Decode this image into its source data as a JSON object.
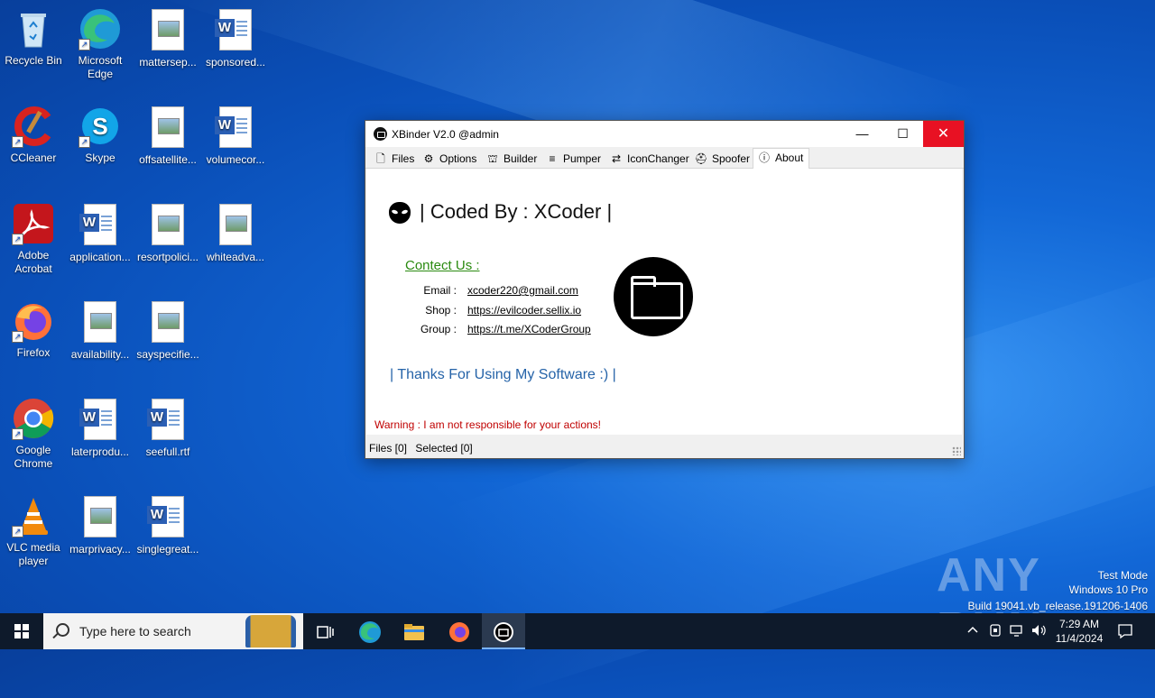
{
  "desktop": {
    "icons": [
      {
        "label": "Recycle Bin"
      },
      {
        "label": "Microsoft Edge"
      },
      {
        "label": "mattersep..."
      },
      {
        "label": "sponsored..."
      },
      {
        "label": "CCleaner"
      },
      {
        "label": "Skype"
      },
      {
        "label": "offsatellite..."
      },
      {
        "label": "volumecor..."
      },
      {
        "label": "Adobe Acrobat"
      },
      {
        "label": "application..."
      },
      {
        "label": "resortpolici..."
      },
      {
        "label": "whiteadva..."
      },
      {
        "label": "Firefox"
      },
      {
        "label": "availability..."
      },
      {
        "label": "sayspecifie..."
      },
      {
        "label": "Google Chrome"
      },
      {
        "label": "laterprodu..."
      },
      {
        "label": "seefull.rtf"
      },
      {
        "label": "VLC media player"
      },
      {
        "label": "marprivacy..."
      },
      {
        "label": "singlegreat..."
      }
    ]
  },
  "window": {
    "title": "XBinder V2.0 @admin",
    "controls": {
      "minimize": "—",
      "maximize": "☐",
      "close": "✕"
    },
    "tabs": [
      {
        "label": "Files",
        "icon": "file-icon"
      },
      {
        "label": "Options",
        "icon": "gear-icon"
      },
      {
        "label": "Builder",
        "icon": "build-icon"
      },
      {
        "label": "Pumper",
        "icon": "pump-icon"
      },
      {
        "label": "IconChanger",
        "icon": "refresh-icon"
      },
      {
        "label": "Spoofer",
        "icon": "spy-icon"
      },
      {
        "label": "About",
        "icon": "info-icon"
      }
    ],
    "active_tab": "About",
    "about": {
      "coded_by": "| Coded By : XCoder |",
      "contact_heading": "Contect Us :",
      "email_label": "Email :",
      "email_value": "xcoder220@gmail.com",
      "shop_label": "Shop :",
      "shop_value": "https://evilcoder.sellix.io",
      "group_label": "Group :",
      "group_value": "https://t.me/XCoderGroup",
      "thanks": "| Thanks For Using My Software :) |",
      "warning": "Warning : I am not responsible for your actions!"
    },
    "status": {
      "files": "Files [0]",
      "selected": "Selected [0]"
    }
  },
  "watermark": {
    "brand": "ANY RUN",
    "line1": "Test Mode",
    "line2": "Windows 10 Pro",
    "line3": "Build 19041.vb_release.191206-1406"
  },
  "taskbar": {
    "search_placeholder": "Type here to search",
    "time": "7:29 AM",
    "date": "11/4/2024"
  }
}
